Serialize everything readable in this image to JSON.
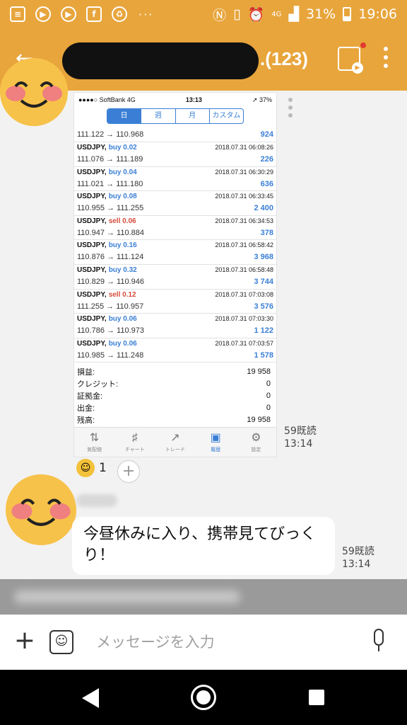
{
  "status_bar": {
    "net_label": "4G",
    "battery_percent": "31%",
    "time": "19:06",
    "icons": [
      "notes-icon",
      "youtube-icon",
      "youtube-icon",
      "facebook-icon",
      "recycle-icon",
      "more-dots-icon",
      "nfc-icon",
      "vibrate-icon",
      "alarm-icon",
      "signal-icon",
      "battery-icon"
    ]
  },
  "header": {
    "member_count": ".(123)",
    "icons": [
      "back-arrow-icon",
      "album-icon",
      "kebab-menu-icon"
    ]
  },
  "screenshot": {
    "ios_status": {
      "carrier": "●●●●○ SoftBank 4G",
      "time": "13:13",
      "battery": "➚ 37%"
    },
    "period_tabs": [
      {
        "label": "日",
        "active": true
      },
      {
        "label": "週",
        "active": false
      },
      {
        "label": "月",
        "active": false
      },
      {
        "label": "カスタム",
        "active": false
      }
    ],
    "first_row": {
      "prices": "111.122 → 110.968",
      "profit": "924"
    },
    "trades": [
      {
        "pair": "USDJPY,",
        "side": "buy",
        "lots": "buy 0.02",
        "date": "2018.07.31 06:08:26",
        "prices": "111.076 → 111.189",
        "profit": "226"
      },
      {
        "pair": "USDJPY,",
        "side": "buy",
        "lots": "buy 0.04",
        "date": "2018.07.31 06:30:29",
        "prices": "111.021 → 111.180",
        "profit": "636"
      },
      {
        "pair": "USDJPY,",
        "side": "buy",
        "lots": "buy 0.08",
        "date": "2018.07.31 06:33:45",
        "prices": "110.955 → 111.255",
        "profit": "2 400"
      },
      {
        "pair": "USDJPY,",
        "side": "sell",
        "lots": "sell 0.06",
        "date": "2018.07.31 06:34:53",
        "prices": "110.947 → 110.884",
        "profit": "378"
      },
      {
        "pair": "USDJPY,",
        "side": "buy",
        "lots": "buy 0.16",
        "date": "2018.07.31 06:58:42",
        "prices": "110.876 → 111.124",
        "profit": "3 968"
      },
      {
        "pair": "USDJPY,",
        "side": "buy",
        "lots": "buy 0.32",
        "date": "2018.07.31 06:58:48",
        "prices": "110.829 → 110.946",
        "profit": "3 744"
      },
      {
        "pair": "USDJPY,",
        "side": "sell",
        "lots": "sell 0.12",
        "date": "2018.07.31 07:03:08",
        "prices": "111.255 → 110.957",
        "profit": "3 576"
      },
      {
        "pair": "USDJPY,",
        "side": "buy",
        "lots": "buy 0.06",
        "date": "2018.07.31 07:03:30",
        "prices": "110.786 → 110.973",
        "profit": "1 122"
      },
      {
        "pair": "USDJPY,",
        "side": "buy",
        "lots": "buy 0.06",
        "date": "2018.07.31 07:03:57",
        "prices": "110.985 → 111.248",
        "profit": "1 578"
      }
    ],
    "summary": [
      {
        "label": "損益:",
        "value": "19 958"
      },
      {
        "label": "クレジット:",
        "value": "0"
      },
      {
        "label": "証拠金:",
        "value": "0"
      },
      {
        "label": "出金:",
        "value": "0"
      },
      {
        "label": "残高:",
        "value": "19 958"
      }
    ],
    "tabs": [
      {
        "label": "気配値",
        "icon": "quotes-icon",
        "glyph": "⇅",
        "active": false
      },
      {
        "label": "チャート",
        "icon": "chart-icon",
        "glyph": "♯",
        "active": false
      },
      {
        "label": "トレード",
        "icon": "trade-icon",
        "glyph": "↗",
        "active": false
      },
      {
        "label": "履歴",
        "icon": "history-icon",
        "glyph": "▣",
        "active": true
      },
      {
        "label": "設定",
        "icon": "settings-icon",
        "glyph": "⚙",
        "active": false
      }
    ]
  },
  "message1_meta": {
    "read": "59既読",
    "time": "13:14"
  },
  "reaction": {
    "count": "1",
    "add_label": "+"
  },
  "message2": {
    "text": "今昼休みに入り、携帯見てびっくり！",
    "read": "59既読",
    "time": "13:14"
  },
  "input_bar": {
    "plus_label": "+",
    "placeholder": "メッセージを入力"
  },
  "colors": {
    "header": "#e8a53c",
    "buy": "#3a7fd5",
    "sell": "#d64a3a"
  }
}
